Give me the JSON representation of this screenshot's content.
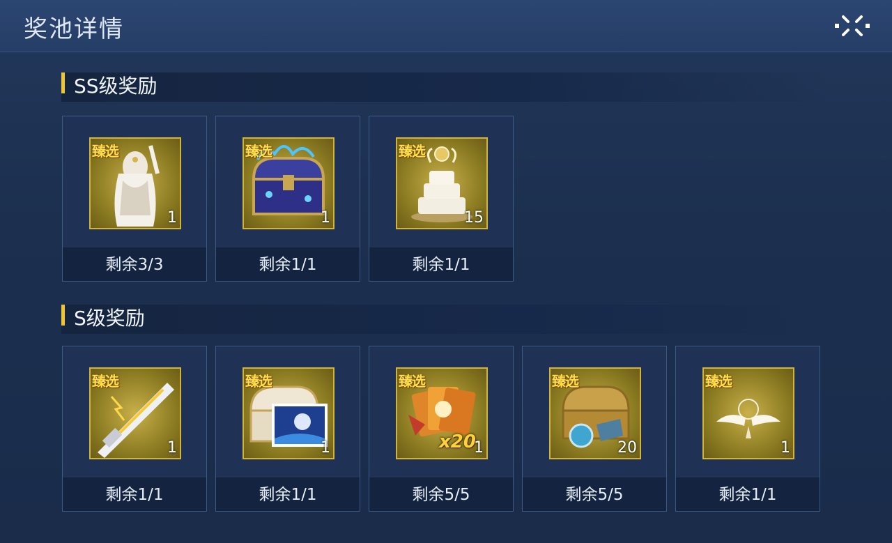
{
  "header": {
    "title": "奖池详情"
  },
  "sections": [
    {
      "title": "SS级奖励",
      "items": [
        {
          "tag": "臻选",
          "qty": "1",
          "remaining": "剩余3/3",
          "icon": "character-skin-icon"
        },
        {
          "tag": "臻选",
          "qty": "1",
          "remaining": "剩余1/1",
          "icon": "treasure-chest-icon"
        },
        {
          "tag": "臻选",
          "qty": "15",
          "remaining": "剩余1/1",
          "icon": "cake-icon"
        }
      ]
    },
    {
      "title": "S级奖励",
      "items": [
        {
          "tag": "臻选",
          "qty": "1",
          "remaining": "剩余1/1",
          "icon": "weapon-skin-icon"
        },
        {
          "tag": "臻选",
          "qty": "1",
          "remaining": "剩余1/1",
          "icon": "chest-with-picture-icon"
        },
        {
          "tag": "臻选",
          "qty": "1",
          "remaining": "剩余5/5",
          "icon": "card-pack-x20-icon",
          "badge": "x20"
        },
        {
          "tag": "臻选",
          "qty": "20",
          "remaining": "剩余5/5",
          "icon": "gold-chest-icon"
        },
        {
          "tag": "臻选",
          "qty": "1",
          "remaining": "剩余1/1",
          "icon": "wings-emblem-icon"
        }
      ]
    }
  ],
  "colors": {
    "accent": "#f2c62b",
    "icon_frame": "#d3b437",
    "panel": "#1f3256"
  }
}
